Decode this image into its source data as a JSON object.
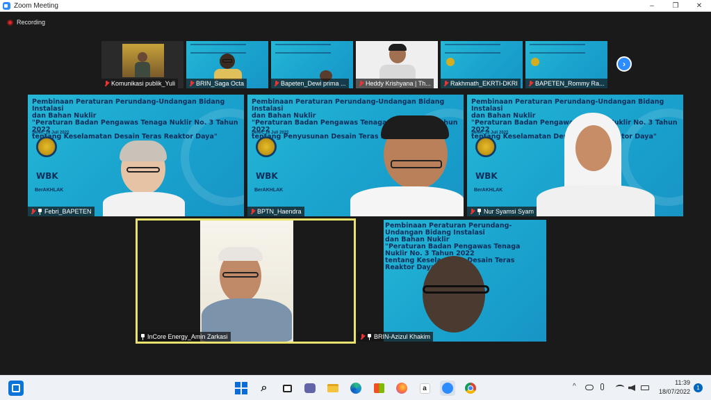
{
  "window": {
    "title": "Zoom Meeting",
    "minimize": "–",
    "maximize": "❐",
    "close": "✕"
  },
  "recording": {
    "label": "Recording"
  },
  "thumbnails": [
    {
      "name": "Komunikasi publik_Yuli"
    },
    {
      "name": "BRIN_Saga Octa"
    },
    {
      "name": "Bapeten_Dewi prima ..."
    },
    {
      "name": "Heddy Krishyana | Th..."
    },
    {
      "name": "Rakhmath_EKRTI-DKRI"
    },
    {
      "name": "BAPETEN_Rommy Ra..."
    }
  ],
  "next_label": "›",
  "slide": {
    "title": "Pembinaan Peraturan Perundang-Undangan Bidang Instalasi\ndan Bahan Nuklir\n\"Peraturan Badan Pengawas Tenaga Nuklir No. 3 Tahun 2022\ntentang Penyusunan Desain Teras Reaktor Daya\"",
    "title_alt": "Pembinaan Peraturan Perundang-Undangan Bidang Instalasi\ndan Bahan Nuklir\n\"Peraturan Badan Pengawas Tenaga Nuklir No. 3 Tahun 2022\ntentang Keselamatan Desain Teras Reaktor Daya\"",
    "date": "Senin, 18 Juli 2022",
    "wbk": "WBK",
    "berakhlak": "BerAKHLAK"
  },
  "tiles": [
    {
      "name": "Febri_BAPETEN"
    },
    {
      "name": "BPTN_Haendra"
    },
    {
      "name": "Nur Syamsi Syam"
    },
    {
      "name": "InCore Energy_Amin Zarkasi"
    },
    {
      "name": "BRIN-Azizul Khakim"
    }
  ],
  "taskbar": {
    "time": "11:39",
    "date": "18/07/2022",
    "notifications": "1",
    "tray_chevron": "^",
    "search_glyph": "⌕"
  }
}
